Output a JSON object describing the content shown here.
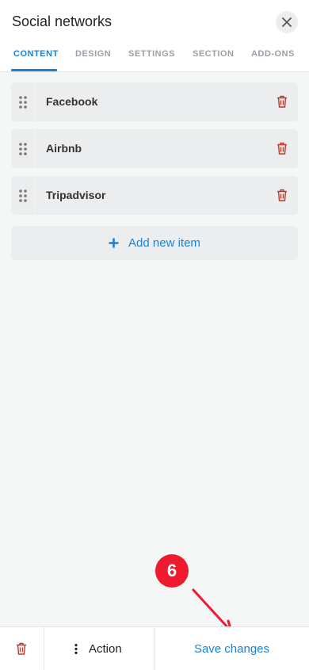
{
  "header": {
    "title": "Social networks",
    "tabs": [
      {
        "label": "CONTENT",
        "active": true
      },
      {
        "label": "DESIGN",
        "active": false
      },
      {
        "label": "SETTINGS",
        "active": false
      },
      {
        "label": "SECTION",
        "active": false
      },
      {
        "label": "ADD-ONS",
        "active": false
      }
    ]
  },
  "items": [
    {
      "label": "Facebook"
    },
    {
      "label": "Airbnb"
    },
    {
      "label": "Tripadvisor"
    }
  ],
  "add_item": {
    "label": "Add new item"
  },
  "annotation": {
    "step_number": "6"
  },
  "bottombar": {
    "action_label": "Action",
    "save_label": "Save changes"
  },
  "colors": {
    "accent": "#1a82d6",
    "danger": "#c0392b",
    "badge": "#ee1b2e"
  },
  "icons": {
    "close": "close-icon",
    "drag": "drag-handle-icon",
    "delete": "trash-icon",
    "add": "plus-icon",
    "more": "more-vertical-icon"
  }
}
